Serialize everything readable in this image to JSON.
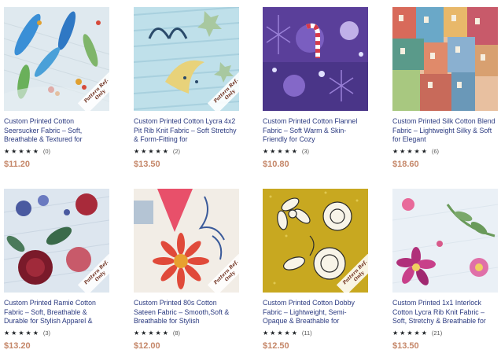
{
  "products": [
    {
      "title": "Custom Printed Cotton Seersucker Fabric – Soft, Breathable & Textured for",
      "rating": "★★★★★",
      "count": "(0)",
      "price": "$11.20",
      "badge": "Pattern Ref. Only",
      "icon": "fabric-feathers-image"
    },
    {
      "title": "Custom Printed Cotton Lycra 4x2 Pit Rib Knit Fabric – Soft Stretchy & Form-Fitting for",
      "rating": "★★★★★",
      "count": "(2)",
      "price": "$13.50",
      "badge": "Pattern Ref. Only",
      "icon": "fabric-moon-image"
    },
    {
      "title": "Custom Printed Cotton Flannel Fabric – Soft Warm & Skin-Friendly for Cozy",
      "rating": "★★★★★",
      "count": "(3)",
      "price": "$10.80",
      "badge": "",
      "icon": "fabric-winter-image"
    },
    {
      "title": "Custom Printed Silk Cotton Blend Fabric – Lightweight Silky & Soft for Elegant",
      "rating": "★★★★★",
      "count": "(6)",
      "price": "$18.60",
      "badge": "",
      "icon": "fabric-houses-image"
    },
    {
      "title": "Custom Printed Ramie Cotton Fabric – Soft, Breathable & Durable for Stylish Apparel &",
      "rating": "★★★★★",
      "count": "(3)",
      "price": "$13.20",
      "badge": "Pattern Ref. Only",
      "icon": "fabric-roses-image"
    },
    {
      "title": "Custom Printed 80s Cotton Sateen Fabric – Smooth,Soft & Breathable for Stylish",
      "rating": "★★★★★",
      "count": "(8)",
      "price": "$12.00",
      "badge": "Pattern Ref. Only",
      "icon": "fabric-daisy-image"
    },
    {
      "title": "Custom Printed Cotton Dobby Fabric – Lightweight, Semi-Opaque & Breathable for",
      "rating": "★★★★★",
      "count": "(11)",
      "price": "$12.50",
      "badge": "Pattern Ref. Only",
      "icon": "fabric-lineart-flowers-image"
    },
    {
      "title": "Custom Printed 1x1 Interlock Cotton Lycra Rib Knit Fabric – Soft, Stretchy & Breathable for",
      "rating": "★★★★★",
      "count": "(21)",
      "price": "$13.50",
      "badge": "",
      "icon": "fabric-pink-flowers-image"
    }
  ]
}
